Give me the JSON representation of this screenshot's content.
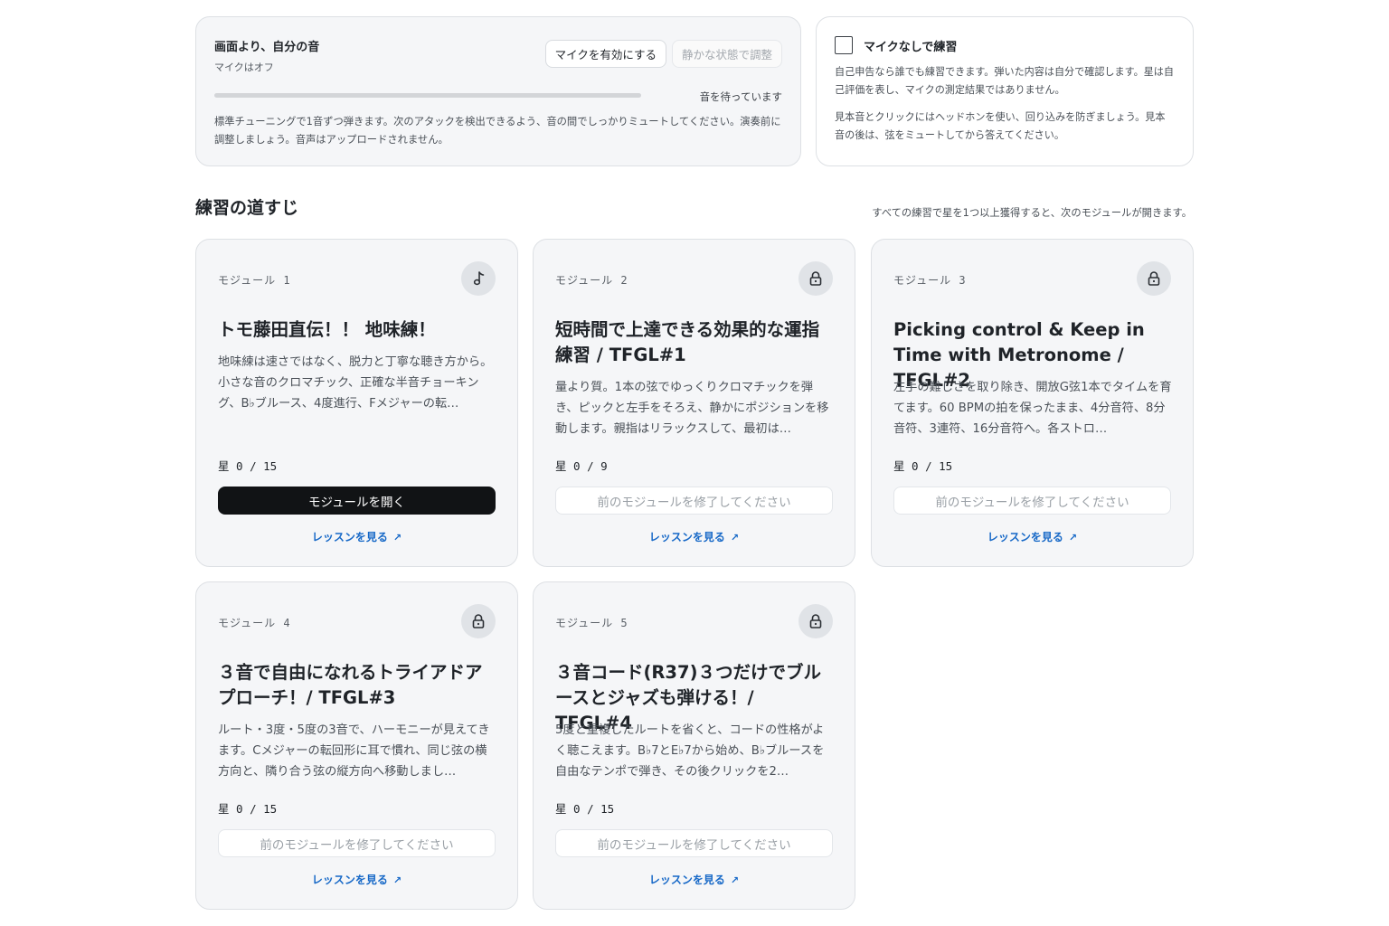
{
  "mic_panel": {
    "title": "画面より、自分の音",
    "status": "マイクはオフ",
    "enable_button": "マイクを有効にする",
    "calibrate_button": "静かな状態で調整",
    "meter_label": "音を待っています",
    "meter_level": 0,
    "description": "標準チューニングで1音ずつ弾きます。次のアタックを検出できるよう、音の間でしっかりミュートしてください。演奏前に調整しましょう。音声はアップロードされません。"
  },
  "nomic_panel": {
    "title": "マイクなしで練習",
    "checked": false,
    "text1": "自己申告なら誰でも練習できます。弾いた内容は自分で確認します。星は自己評価を表し、マイクの測定結果ではありません。",
    "text2": "見本音とクリックにはヘッドホンを使い、回り込みを防ぎましょう。見本音の後は、弦をミュートしてから答えてください。"
  },
  "section": {
    "title": "練習の道すじ",
    "note": "すべての練習で星を1つ以上獲得すると、次のモジュールが開きます。"
  },
  "modules": [
    {
      "label": "モジュール 1",
      "icon": "music-note-icon",
      "title": "トモ藤田直伝！！ 地味練！",
      "description": "地味練は速さではなく、脱力と丁寧な聴き方から。小さな音のクロマチック、正確な半音チョーキング、B♭ブルース、4度進行、Fメジャーの転…",
      "stars": "星 0 / 15",
      "button": "モジュールを開く",
      "link": "レッスンを見る",
      "locked": false
    },
    {
      "label": "モジュール 2",
      "icon": "lock-icon",
      "title": "短時間で上達できる効果的な運指練習 / TFGL#1",
      "description": "量より質。1本の弦でゆっくりクロマチックを弾き、ピックと左手をそろえ、静かにポジションを移動します。親指はリラックスして、最初は…",
      "stars": "星 0 / 9",
      "button": "前のモジュールを修了してください",
      "link": "レッスンを見る",
      "locked": true
    },
    {
      "label": "モジュール 3",
      "icon": "lock-icon",
      "title": "Picking control & Keep in Time with Metronome / TFGL#2",
      "description": "左手の難しさを取り除き、開放G弦1本でタイムを育てます。60 BPMの拍を保ったまま、4分音符、8分音符、3連符、16分音符へ。各ストロ…",
      "stars": "星 0 / 15",
      "button": "前のモジュールを修了してください",
      "link": "レッスンを見る",
      "locked": true
    },
    {
      "label": "モジュール 4",
      "icon": "lock-icon",
      "title": "３音で自由になれるトライアドアプローチ！/ TFGL#3",
      "description": "ルート・3度・5度の3音で、ハーモニーが見えてきます。Cメジャーの転回形に耳で慣れ、同じ弦の横方向と、隣り合う弦の縦方向へ移動しまし…",
      "stars": "星 0 / 15",
      "button": "前のモジュールを修了してください",
      "link": "レッスンを見る",
      "locked": true
    },
    {
      "label": "モジュール 5",
      "icon": "lock-icon",
      "title": "３音コード(R37)３つだけでブルースとジャズも弾ける！/ TFGL#4",
      "description": "5度と重複したルートを省くと、コードの性格がよく聴こえます。B♭7とE♭7から始め、B♭ブルースを自由なテンポで弾き、その後クリックを2…",
      "stars": "星 0 / 15",
      "button": "前のモジュールを修了してください",
      "link": "レッスンを見る",
      "locked": true
    }
  ]
}
